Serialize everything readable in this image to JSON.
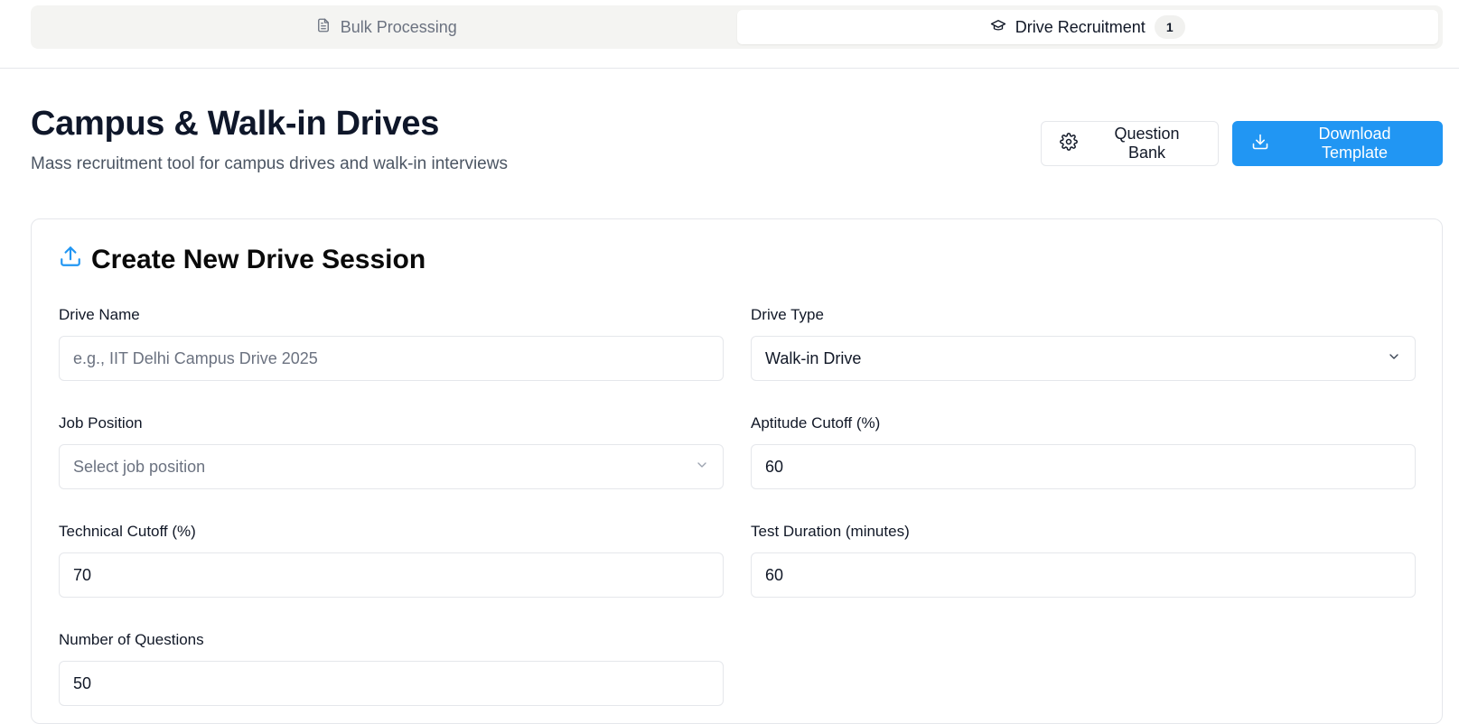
{
  "tabs": [
    {
      "label": "Bulk Processing",
      "icon": "file-text-icon",
      "active": false
    },
    {
      "label": "Drive Recruitment",
      "icon": "graduation-cap-icon",
      "active": true,
      "badge": "1"
    }
  ],
  "header": {
    "title": "Campus & Walk-in Drives",
    "subtitle": "Mass recruitment tool for campus drives and walk-in interviews",
    "question_bank_label": "Question Bank",
    "download_template_label": "Download Template"
  },
  "form": {
    "title": "Create New Drive Session",
    "drive_name": {
      "label": "Drive Name",
      "value": "",
      "placeholder": "e.g., IIT Delhi Campus Drive 2025"
    },
    "drive_type": {
      "label": "Drive Type",
      "value": "Walk-in Drive"
    },
    "job_position": {
      "label": "Job Position",
      "value": "",
      "placeholder": "Select job position"
    },
    "aptitude_cutoff": {
      "label": "Aptitude Cutoff (%)",
      "value": "60"
    },
    "technical_cutoff": {
      "label": "Technical Cutoff (%)",
      "value": "70"
    },
    "test_duration": {
      "label": "Test Duration (minutes)",
      "value": "60"
    },
    "num_questions": {
      "label": "Number of Questions",
      "value": "50"
    }
  },
  "colors": {
    "primary": "#2196f3",
    "border": "#e5e7eb",
    "tab_background": "#f4f4f2",
    "muted_text": "#6b7280"
  }
}
